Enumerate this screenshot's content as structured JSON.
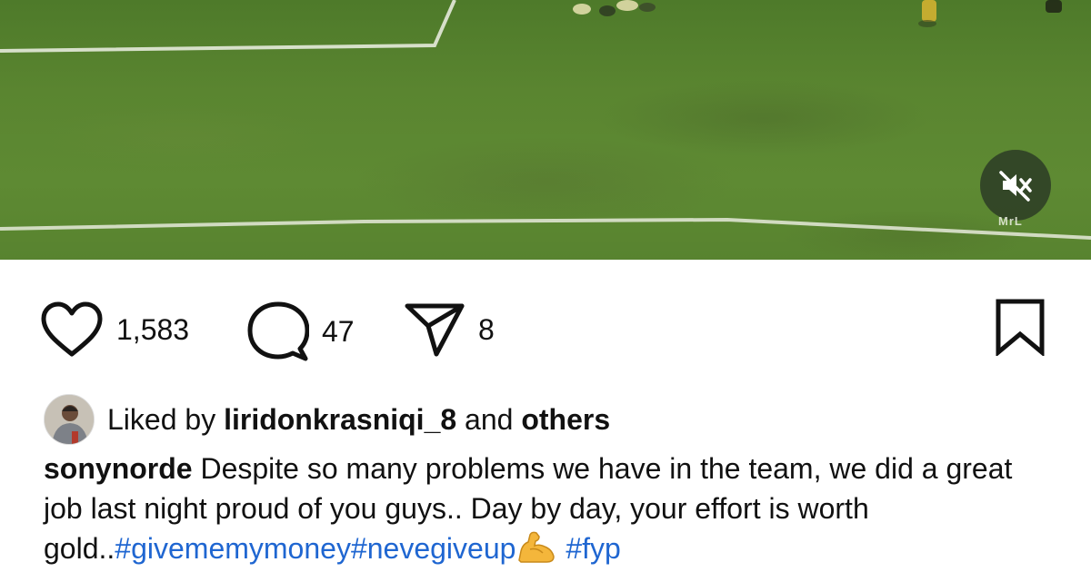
{
  "video": {
    "watermark": "MrL",
    "mute_icon": "speaker-muted-icon",
    "colors": {
      "grass": "#5a8530",
      "line": "#e6eadb"
    }
  },
  "actions": {
    "like": {
      "icon": "heart-icon",
      "count": "1,583"
    },
    "comment": {
      "icon": "comment-bubble-icon",
      "count": "47"
    },
    "share": {
      "icon": "paper-plane-icon",
      "count": "8"
    },
    "save": {
      "icon": "bookmark-icon"
    }
  },
  "likes": {
    "prefix": "Liked by",
    "user": "liridonkrasniqi_8",
    "connector": "and",
    "suffix": "others"
  },
  "caption": {
    "username": "sonynorde",
    "text": "Despite so many problems we have in the team, we did a great job last night proud of you guys.. Day by day, your effort is worth gold..",
    "hashtags": [
      "#givememymoney",
      "#nevegiveup",
      "#fyp"
    ],
    "emoji": "flexed-biceps-emoji"
  },
  "colors": {
    "hashtag": "#1f66d1",
    "text": "#111111",
    "background": "#ffffff"
  }
}
